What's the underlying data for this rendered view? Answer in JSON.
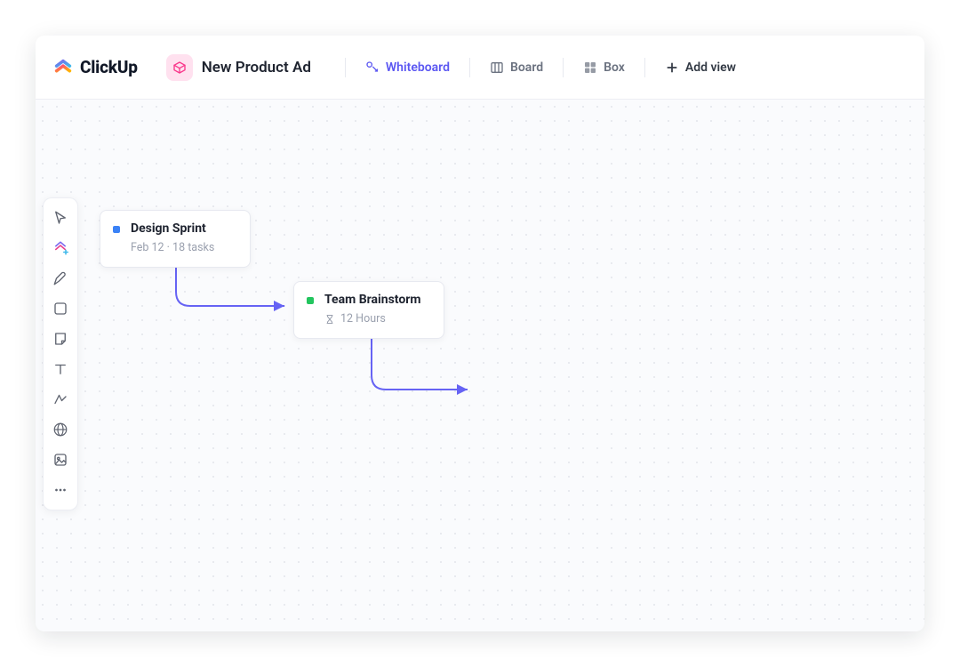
{
  "brand": {
    "name": "ClickUp"
  },
  "space": {
    "name": "New Product Ad"
  },
  "views": {
    "whiteboard": "Whiteboard",
    "board": "Board",
    "box": "Box",
    "add": "Add view"
  },
  "toolbox": {
    "select": "select",
    "clickitem": "click-item",
    "pen": "pen",
    "shape": "shape",
    "sticky": "sticky",
    "text": "text",
    "connector": "connector",
    "web": "web",
    "image": "image",
    "more": "more"
  },
  "cards": {
    "sprint": {
      "title": "Design Sprint",
      "meta": "Feb 12  ·  18 tasks",
      "color": "#3b82f6"
    },
    "brainstorm": {
      "title": "Team Brainstorm",
      "meta": "12 Hours",
      "color": "#22c55e"
    }
  }
}
